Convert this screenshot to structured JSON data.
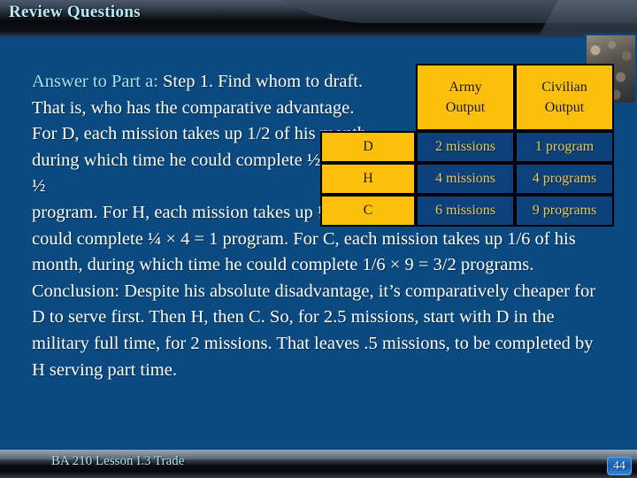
{
  "slide": {
    "title": "Review Questions",
    "footer_label": "BA 210  Lesson I.3 Trade",
    "slide_number": "44",
    "accent_cyan": "#9fe4f2",
    "background_blue": "#0b4a80",
    "table_gold": "#fcc00a",
    "table_data_bg": "#0d417c",
    "table_data_text": "#e8c94f"
  },
  "body": {
    "lead_label": "Answer to Part a:",
    "narrow_text": " Step 1.  Find whom to draft. That is, who has the comparative advantage. For D, each mission takes up 1/2 of his month, during which time he could complete ½ × 1 = ½",
    "wide_text": "program.  For H, each mission takes up ¼ of his month, during which time he could complete ¼ × 4 = 1 program.  For C, each mission takes up 1/6 of his month, during which time he could complete 1/6 × 9 = 3/2 programs.",
    "conclusion_text": "Conclusion: Despite his absolute disadvantage, it’s comparatively cheaper for D to serve first. Then H, then C. So, for 2.5 missions, start with D in the military full time, for 2 missions. That leaves .5 missions, to be completed by H serving part time."
  },
  "table": {
    "corner_label": "",
    "columns": [
      "Army Output",
      "Civilian Output"
    ],
    "column_lines": [
      [
        "Army",
        "Output"
      ],
      [
        "Civilian",
        "Output"
      ]
    ],
    "rows": [
      {
        "label": "D",
        "army": "2 missions",
        "civilian": "1 program"
      },
      {
        "label": "H",
        "army": "4 missions",
        "civilian": "4 programs"
      },
      {
        "label": "C",
        "army": "6 missions",
        "civilian": "9 programs"
      }
    ]
  }
}
